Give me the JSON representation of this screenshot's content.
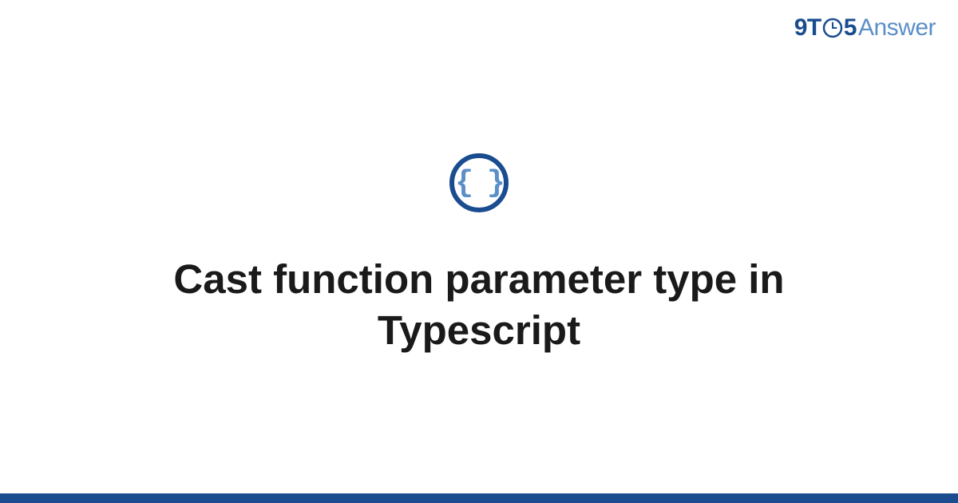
{
  "header": {
    "logo": {
      "part1": "9T",
      "part2": "5",
      "part3": "Answer"
    }
  },
  "content": {
    "icon_label": "code-braces",
    "icon_text": "{ }",
    "title": "Cast function parameter type in Typescript"
  },
  "colors": {
    "primary": "#1a4d8f",
    "secondary": "#5a8fc7",
    "text": "#1a1a1a"
  }
}
